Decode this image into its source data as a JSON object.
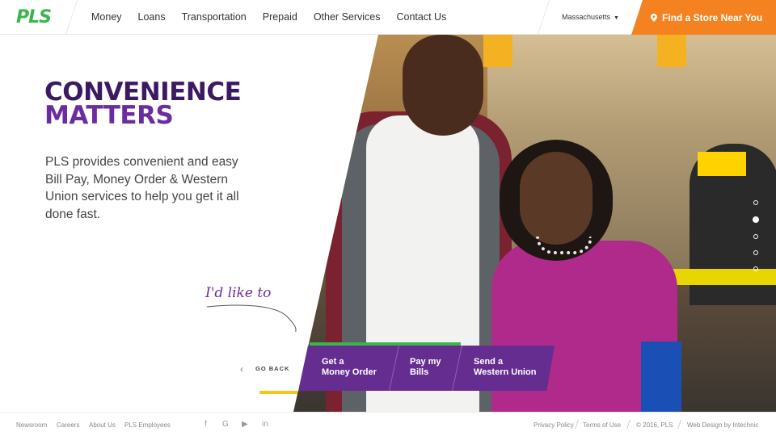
{
  "header": {
    "logo": "PLS",
    "nav": [
      "Money",
      "Loans",
      "Transportation",
      "Prepaid",
      "Other Services",
      "Contact Us"
    ],
    "state": "Massachusetts",
    "find_store": "Find a Store Near You"
  },
  "hero": {
    "headline_1": "CONVENIENCE",
    "headline_2": "MATTERS",
    "intro": "PLS provides convenient and easy Bill Pay, Money Order & Western Union services to help you get it all done fast.",
    "script": "I'd like to"
  },
  "actions": {
    "go_back": "GO BACK",
    "items": [
      {
        "line1": "Get a",
        "line2": "Money Order"
      },
      {
        "line1": "Pay my",
        "line2": "Bills"
      },
      {
        "line1": "Send a",
        "line2": "Western Union"
      }
    ]
  },
  "slider": {
    "count": 5,
    "active_index": 1
  },
  "footer": {
    "links_left": [
      "Newsroom",
      "Careers",
      "About Us",
      "PLS Employees"
    ],
    "social": [
      "facebook-icon",
      "google-plus-icon",
      "youtube-icon",
      "linkedin-icon"
    ],
    "privacy": "Privacy Policy",
    "terms": "Terms of Use",
    "copyright": "© 2016, PLS",
    "credit": "Web Design by Intechnic"
  },
  "colors": {
    "brand_green": "#39b54a",
    "orange": "#f58220",
    "purple": "#662d91",
    "dark_purple": "#3b1a63",
    "accent_yellow": "#f5c518"
  }
}
